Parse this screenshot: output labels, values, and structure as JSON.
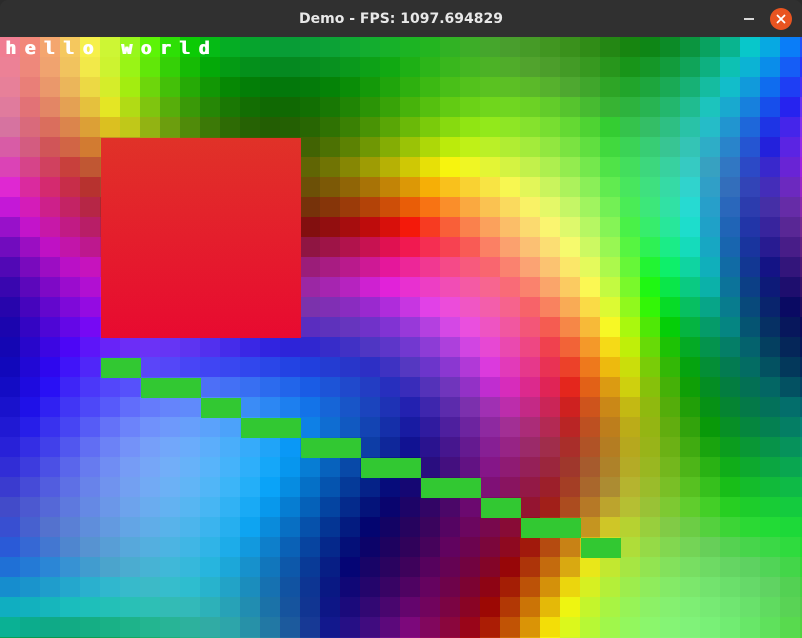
{
  "window": {
    "title": "Demo - FPS: 1097.694829",
    "minimize_icon": "minimize-icon",
    "close_icon": "close-icon",
    "close_color": "#e95420",
    "titlebar_color": "#303030"
  },
  "scene": {
    "hud_text": "hello world",
    "hud_text_color": "#ffffff",
    "rect_top_color": "#e03228",
    "rect_bottom_color": "#e80a30",
    "stair_color": "#32c832"
  }
}
